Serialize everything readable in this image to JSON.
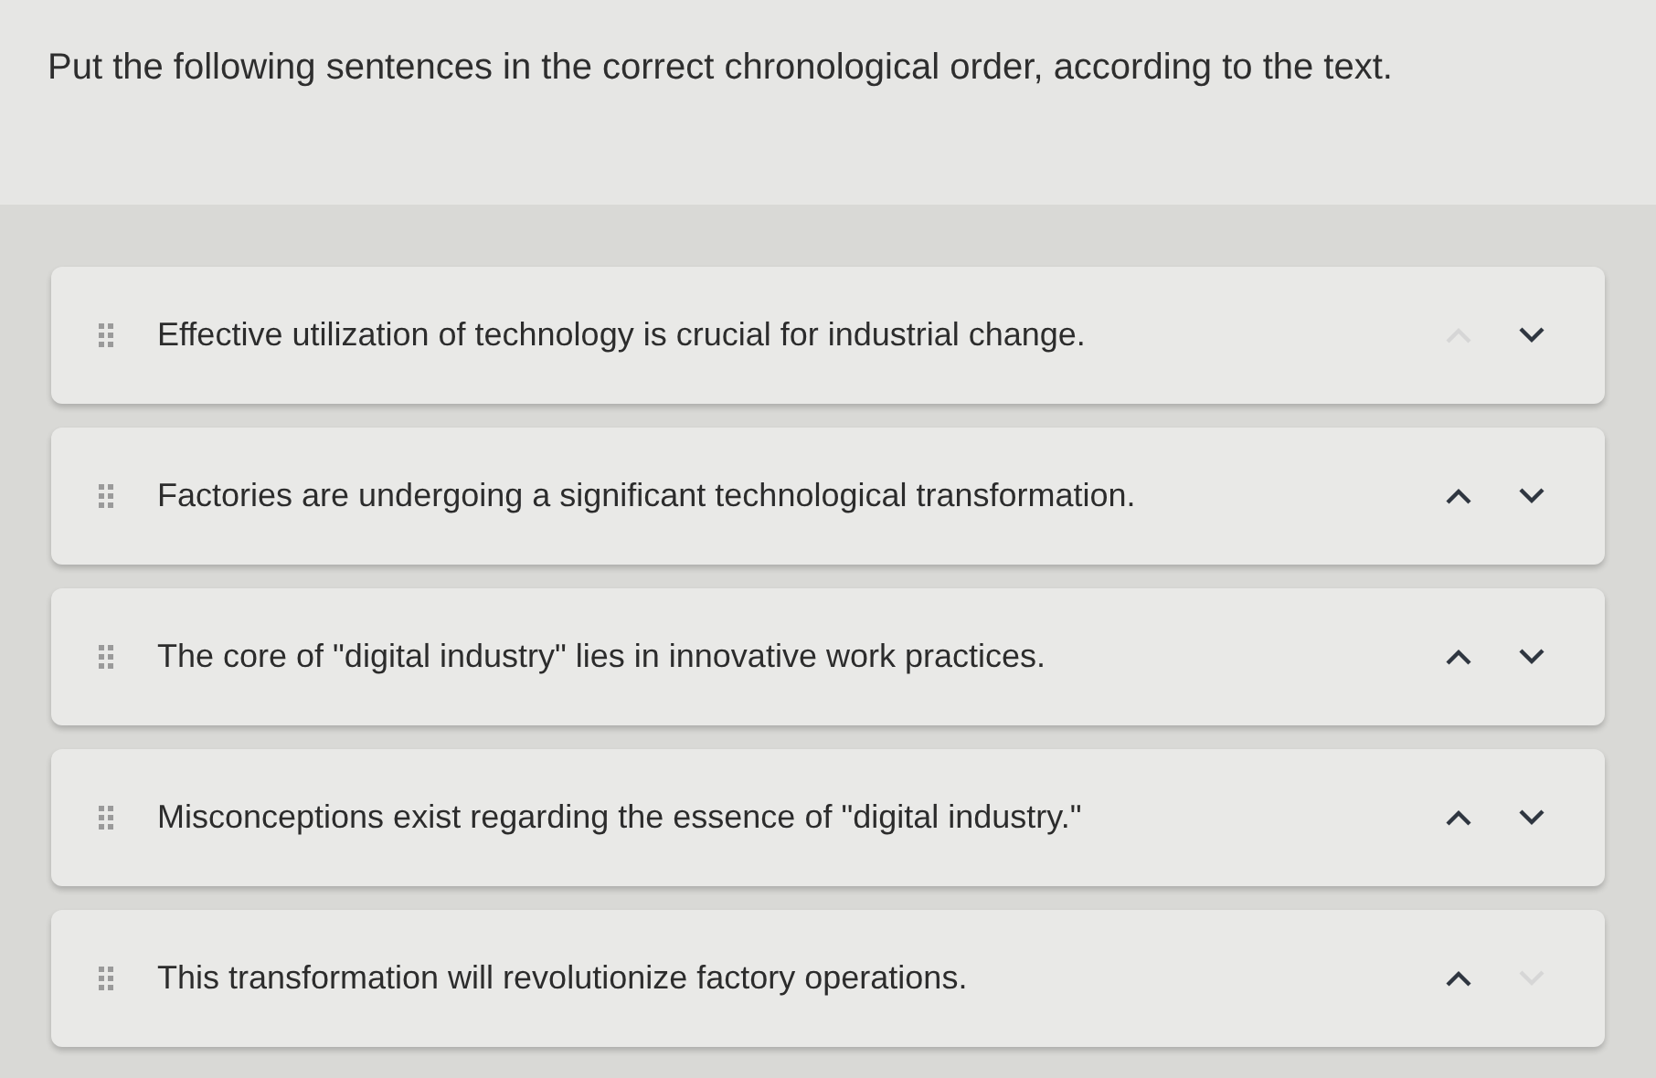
{
  "prompt": "Put the following sentences in the correct chronological order, according to the text.",
  "items": [
    {
      "text": "Effective utilization of technology is crucial for industrial change.",
      "up_enabled": false,
      "down_enabled": true
    },
    {
      "text": "Factories are undergoing a significant technological transformation.",
      "up_enabled": true,
      "down_enabled": true
    },
    {
      "text": "The core of \"digital industry\" lies in innovative work practices.",
      "up_enabled": true,
      "down_enabled": true
    },
    {
      "text": "Misconceptions exist regarding the essence of \"digital industry.\"",
      "up_enabled": true,
      "down_enabled": true
    },
    {
      "text": "This transformation will revolutionize factory operations.",
      "up_enabled": true,
      "down_enabled": false
    }
  ]
}
